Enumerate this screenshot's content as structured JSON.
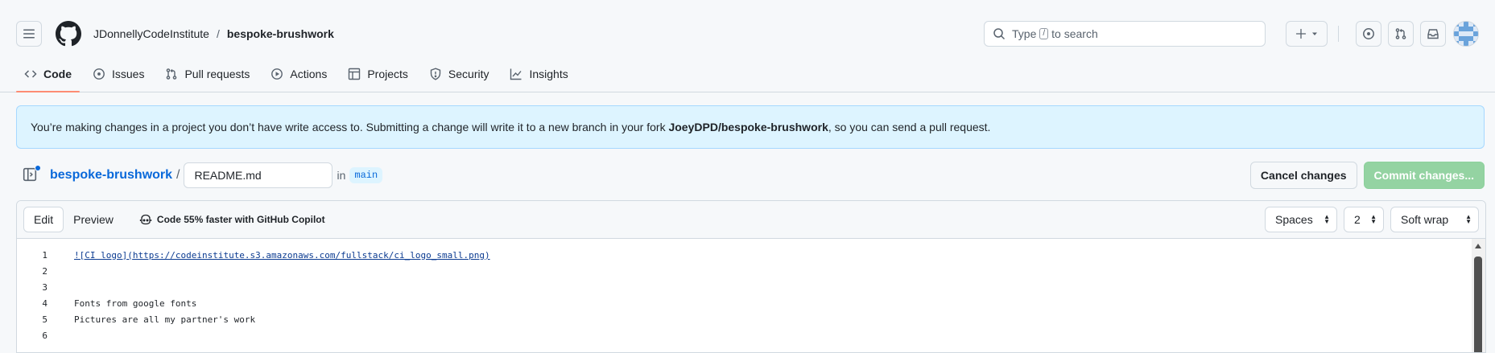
{
  "header": {
    "owner": "JDonnellyCodeInstitute",
    "separator": "/",
    "repo": "bespoke-brushwork",
    "search": {
      "prefix": "Type",
      "key": "/",
      "suffix": "to search"
    }
  },
  "nav": {
    "items": [
      {
        "label": "Code",
        "icon": "code-icon"
      },
      {
        "label": "Issues",
        "icon": "issue-icon"
      },
      {
        "label": "Pull requests",
        "icon": "pull-request-icon"
      },
      {
        "label": "Actions",
        "icon": "play-icon"
      },
      {
        "label": "Projects",
        "icon": "table-icon"
      },
      {
        "label": "Security",
        "icon": "shield-icon"
      },
      {
        "label": "Insights",
        "icon": "graph-icon"
      }
    ]
  },
  "banner": {
    "text_before": "You’re making changes in a project you don’t have write access to. Submitting a change will write it to a new branch in your fork ",
    "fork": "JoeyDPD/bespoke-brushwork",
    "text_after": ", so you can send a pull request."
  },
  "filebar": {
    "repo": "bespoke-brushwork",
    "separator": "/",
    "filename": "README.md",
    "in_label": "in",
    "branch": "main",
    "cancel_label": "Cancel changes",
    "commit_label": "Commit changes..."
  },
  "editor": {
    "tabs": {
      "edit": "Edit",
      "preview": "Preview"
    },
    "copilot": "Code 55% faster with GitHub Copilot",
    "indent_mode": "Spaces",
    "indent_size": "2",
    "wrap_mode": "Soft wrap",
    "lines": [
      {
        "n": "1",
        "prefix": "![CI logo](",
        "link": "https://codeinstitute.s3.amazonaws.com/fullstack/ci_logo_small.png",
        "suffix": ")"
      },
      {
        "n": "2",
        "text": ""
      },
      {
        "n": "3",
        "text": ""
      },
      {
        "n": "4",
        "text": "Fonts from google fonts"
      },
      {
        "n": "5",
        "text": "Pictures are all my partner's work"
      },
      {
        "n": "6",
        "text": ""
      }
    ]
  },
  "colors": {
    "accent_blue": "#0969da",
    "nav_underline": "#fd8c73",
    "banner_bg": "#ddf4ff",
    "commit_disabled": "#94d3a2"
  }
}
